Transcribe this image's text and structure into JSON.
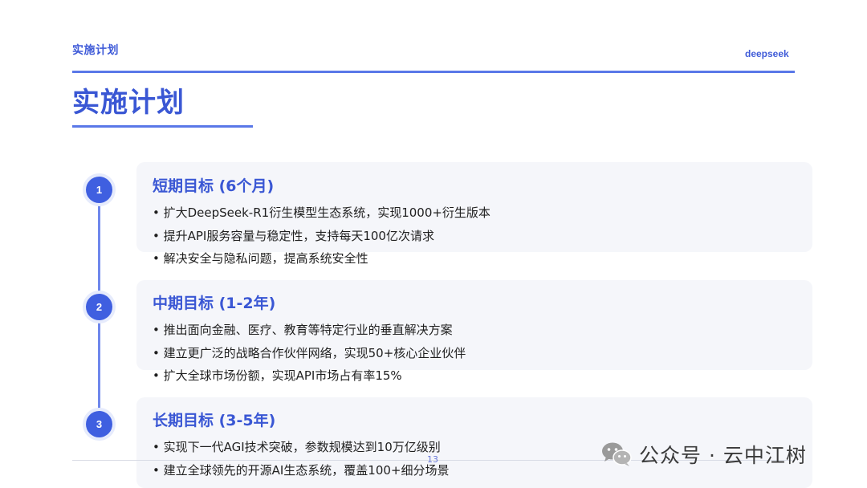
{
  "header": {
    "label": "实施计划",
    "brand": "deepseek"
  },
  "page": {
    "title": "实施计划",
    "number": "13"
  },
  "phases": [
    {
      "number": "1",
      "title": "短期目标 (6个月)",
      "items": [
        "• 扩大DeepSeek-R1衍生模型生态系统，实现1000+衍生版本",
        "• 提升API服务容量与稳定性，支持每天100亿次请求",
        "• 解决安全与隐私问题，提高系统安全性"
      ]
    },
    {
      "number": "2",
      "title": "中期目标 (1-2年)",
      "items": [
        "• 推出面向金融、医疗、教育等特定行业的垂直解决方案",
        "• 建立更广泛的战略合作伙伴网络，实现50+核心企业伙伴",
        "• 扩大全球市场份额，实现API市场占有率15%"
      ]
    },
    {
      "number": "3",
      "title": "长期目标 (3-5年)",
      "items": [
        "• 实现下一代AGI技术突破，参数规模达到10万亿级别",
        "• 建立全球领先的开源AI生态系统，覆盖100+细分场景"
      ]
    }
  ],
  "watermark": {
    "icon": "wechat-icon",
    "text": "公众号 · 云中江树"
  },
  "colors": {
    "accent": "#3f5fe0",
    "card": "#f5f6fa",
    "rule": "#5a78e8"
  }
}
